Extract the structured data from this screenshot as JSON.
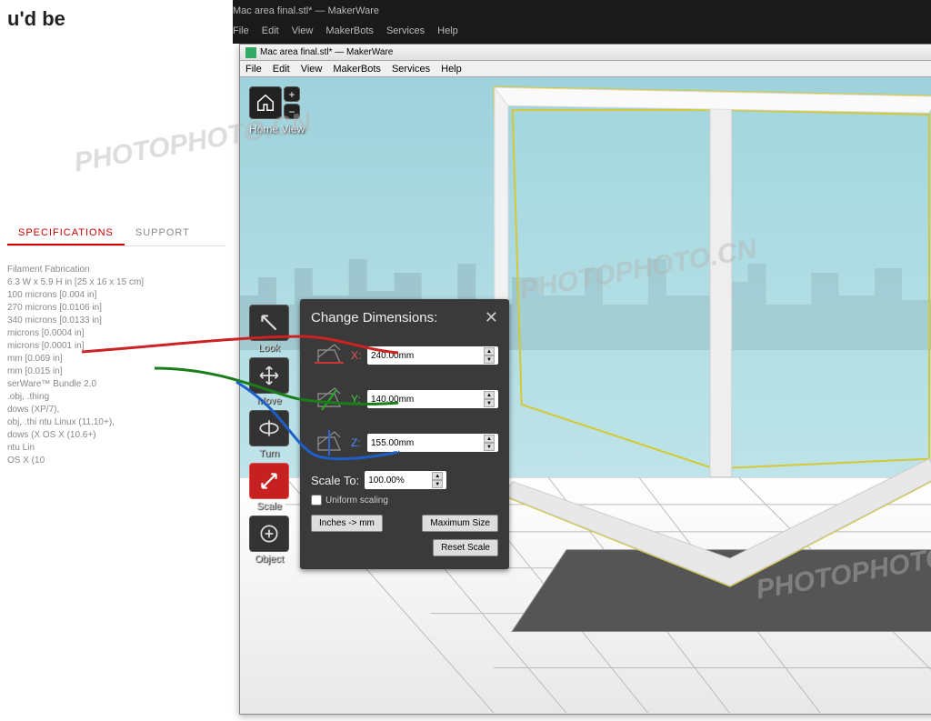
{
  "outer_window": {
    "title": "Mac area final.stl* — MakerWare",
    "menu": [
      "File",
      "Edit",
      "View",
      "MakerBots",
      "Services",
      "Help"
    ]
  },
  "left_panel": {
    "heading": "u'd be",
    "tabs": {
      "specifications": "SPECIFICATIONS",
      "support": "SUPPORT"
    },
    "specs": [
      "Filament Fabrication",
      "6.3 W x 5.9 H in [25 x 16 x 15 cm]",
      "100 microns [0.004 in]",
      "270 microns [0.0106 in]",
      "340 microns [0.0133 in]",
      "microns [0.0004 in]",
      "microns [0.0001 in]",
      "mm [0.069 in]",
      "mm [0.015 in]",
      "",
      "serWare™ Bundle 2.0",
      ".obj, .thing",
      "dows (XP/7),",
      "obj, .thi ntu Linux (11.10+),",
      "dows (X  OS X (10.6+)",
      "ntu Lin",
      "OS X (10"
    ]
  },
  "makerware": {
    "title": "Mac area final.stl* — MakerWare",
    "menu": [
      "File",
      "Edit",
      "View",
      "MakerBots",
      "Services",
      "Help"
    ],
    "home_label": "Home View",
    "tools": {
      "look": "Look",
      "move": "Move",
      "turn": "Turn",
      "scale": "Scale",
      "object": "Object"
    }
  },
  "dimensions_panel": {
    "title": "Change Dimensions:",
    "x": {
      "label": "X:",
      "value": "240.00mm"
    },
    "y": {
      "label": "Y:",
      "value": "140.00mm"
    },
    "z": {
      "label": "Z:",
      "value": "155.00mm"
    },
    "scale_label": "Scale To:",
    "scale_value": "100.00%",
    "uniform_label": "Uniform scaling",
    "units_button": "Inches -> mm",
    "maximum_button": "Maximum Size",
    "reset_button": "Reset Scale"
  },
  "watermark": {
    "text": "PHOTOPHOTO.CN"
  }
}
